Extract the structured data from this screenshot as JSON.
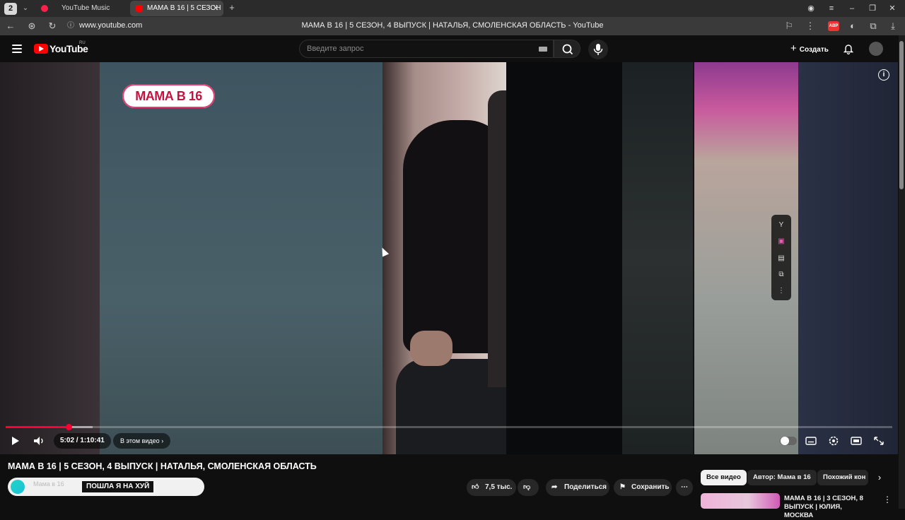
{
  "browser": {
    "tab_count": "2",
    "tabs": [
      {
        "label": "YouTube Music"
      },
      {
        "label": "МАМА В 16 | 5 СЕЗОН"
      }
    ],
    "url": "www.youtube.com",
    "window_title": "МАМА В 16 | 5 СЕЗОН, 4 ВЫПУСК | НАТАЛЬЯ, СМОЛЕНСКАЯ ОБЛАСТЬ - YouTube",
    "adblock_label": "ABP"
  },
  "header": {
    "logo_text": "YouTube",
    "country_code": "RU",
    "search_placeholder": "Введите запрос",
    "create_label": "Создать"
  },
  "player": {
    "badge_text": "МАМА В 16",
    "current_time": "5:02",
    "duration": "1:10:41",
    "time_display": "5:02 / 1:10:41",
    "chapter_label": "В этом видео",
    "progress_fraction": 0.071,
    "buffered_fraction": 0.098,
    "accent_color": "#ff0033"
  },
  "video": {
    "title": "МАМА В 16 | 5 СЕЗОН, 4 ВЫПУСК | НАТАЛЬЯ, СМОЛЕНСКАЯ ОБЛАСТЬ",
    "channel_name": "Мама в 16",
    "subtitle_overlay": "ПОШЛА Я НА ХУЙ",
    "likes": "7,5 тыс.",
    "share_label": "Поделиться",
    "save_label": "Сохранить"
  },
  "recommendations": {
    "chips": [
      "Все видео",
      "Автор: Мама в 16",
      "Похожий кон"
    ],
    "items": [
      {
        "title": "МАМА В 16 | 3 СЕЗОН, 8 ВЫПУСК | ЮЛИЯ, МОСКВА"
      }
    ]
  },
  "icons": [
    "tab-dropdown-icon",
    "new-tab-icon",
    "back-icon",
    "tracking-icon",
    "reload-icon",
    "site-info-icon",
    "bookmark-icon",
    "menu-icon",
    "search-icon",
    "mic-icon",
    "bell-icon",
    "info-icon",
    "play-icon",
    "volume-icon",
    "settings-icon",
    "fullscreen-icon",
    "like-icon",
    "dislike-icon",
    "share-icon",
    "save-icon",
    "more-icon"
  ]
}
